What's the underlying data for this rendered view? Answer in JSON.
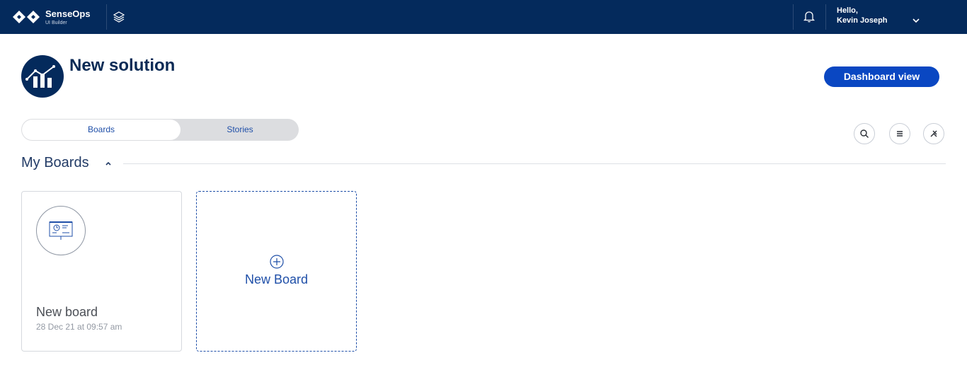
{
  "topbar": {
    "brand_name": "SenseOps",
    "brand_sub": "UI Builder",
    "greeting": "Hello,",
    "user_name": "Kevin Joseph"
  },
  "header": {
    "title": "New solution",
    "dashboard_button": "Dashboard view"
  },
  "tabs": [
    {
      "label": "Boards",
      "active": true
    },
    {
      "label": "Stories",
      "active": false
    }
  ],
  "section": {
    "title": "My Boards"
  },
  "boards": [
    {
      "name": "New board",
      "date": "28 Dec 21 at 09:57 am"
    }
  ],
  "new_board": {
    "label": "New Board"
  },
  "icons": {
    "logo": "senseops-logo-icon",
    "layers": "layers-icon",
    "bell": "bell-icon",
    "chevron": "chevron-down-icon",
    "search": "search-icon",
    "list": "list-icon",
    "tools": "tools-icon",
    "board": "presentation-board-icon",
    "plus": "plus-circle-icon"
  },
  "colors": {
    "topbar": "#042a5c",
    "accent": "#0a47c2",
    "link": "#1f4fa8"
  }
}
